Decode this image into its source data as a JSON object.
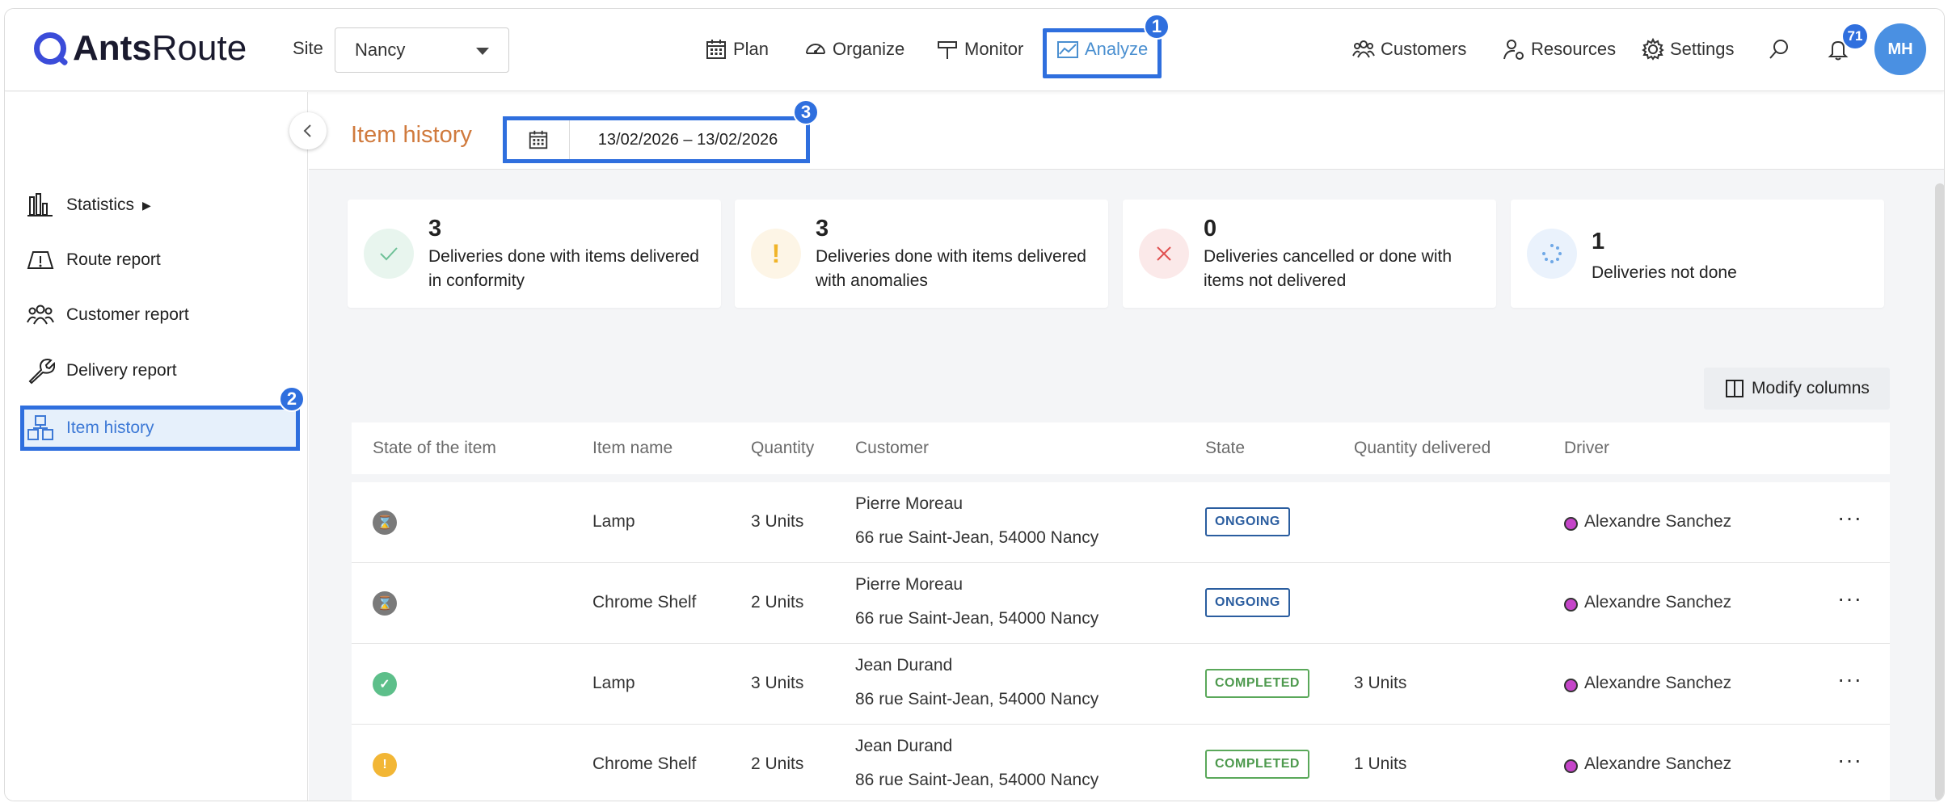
{
  "header": {
    "logo_ants": "Ants",
    "logo_route": "Route",
    "site_label": "Site",
    "site_value": "Nancy",
    "nav": {
      "plan": "Plan",
      "organize": "Organize",
      "monitor": "Monitor",
      "analyze": "Analyze",
      "customers": "Customers",
      "resources": "Resources",
      "settings": "Settings"
    },
    "notification_count": "71",
    "avatar_initials": "MH",
    "badge_1": "1"
  },
  "sidebar": {
    "items": [
      {
        "label": "Statistics",
        "arrow": "▶"
      },
      {
        "label": "Route report"
      },
      {
        "label": "Customer report"
      },
      {
        "label": "Delivery report"
      },
      {
        "label": "Item history"
      }
    ],
    "badge_2": "2"
  },
  "page": {
    "title": "Item history",
    "date_range": "13/02/2026 – 13/02/2026",
    "badge_3": "3"
  },
  "stats": [
    {
      "count": "3",
      "text": "Deliveries done with items delivered in conformity",
      "icon": "check-icon",
      "color": "#4caf7d"
    },
    {
      "count": "3",
      "text": "Deliveries done with items delivered with anomalies",
      "icon": "exclamation-icon",
      "color": "#f0b429"
    },
    {
      "count": "0",
      "text": "Deliveries cancelled or done with items not delivered",
      "icon": "cross-icon",
      "color": "#e05050"
    },
    {
      "count": "1",
      "text": "Deliveries not done",
      "icon": "spinner-icon",
      "color": "#4a90e2"
    }
  ],
  "toolbar": {
    "modify_columns": "Modify columns"
  },
  "table": {
    "columns": [
      "State of the item",
      "Item name",
      "Quantity",
      "Customer",
      "State",
      "Quantity delivered",
      "Driver"
    ],
    "rows": [
      {
        "state_icon": "hourglass-icon",
        "item": "Lamp",
        "quantity": "3 Units",
        "customer": "Pierre Moreau",
        "address": "66 rue Saint-Jean, 54000 Nancy",
        "state": "ONGOING",
        "delivered": "",
        "driver": "Alexandre Sanchez"
      },
      {
        "state_icon": "hourglass-icon",
        "item": "Chrome Shelf",
        "quantity": "2 Units",
        "customer": "Pierre Moreau",
        "address": "66 rue Saint-Jean, 54000 Nancy",
        "state": "ONGOING",
        "delivered": "",
        "driver": "Alexandre Sanchez"
      },
      {
        "state_icon": "check-icon",
        "item": "Lamp",
        "quantity": "3 Units",
        "customer": "Jean Durand",
        "address": "86 rue Saint-Jean, 54000 Nancy",
        "state": "COMPLETED",
        "delivered": "3 Units",
        "driver": "Alexandre Sanchez"
      },
      {
        "state_icon": "exclamation-icon",
        "item": "Chrome Shelf",
        "quantity": "2 Units",
        "customer": "Jean Durand",
        "address": "86 rue Saint-Jean, 54000 Nancy",
        "state": "COMPLETED",
        "delivered": "1 Units",
        "driver": "Alexandre Sanchez"
      }
    ]
  },
  "colors": {
    "accent": "#2f6fde",
    "title_orange": "#d07a3d",
    "driver_dot": "#c545c9"
  }
}
